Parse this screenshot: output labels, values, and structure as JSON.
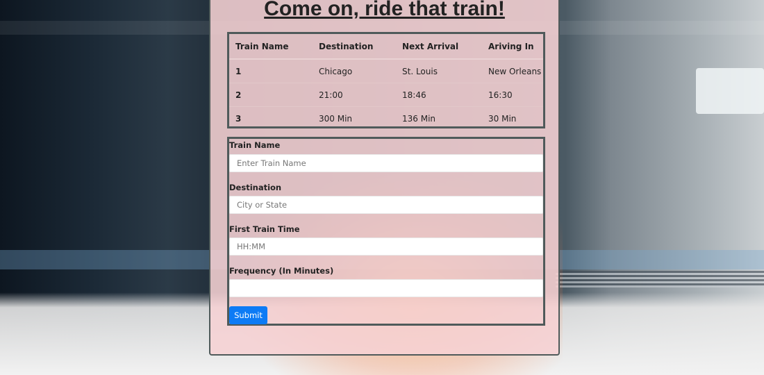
{
  "page": {
    "title": "Come on, ride that train!"
  },
  "table": {
    "headers": [
      "Train Name",
      "Destination",
      "Next Arrival",
      "Ariving In"
    ],
    "rows": [
      [
        "1",
        "Chicago",
        "St. Louis",
        "New Orleans"
      ],
      [
        "2",
        "21:00",
        "18:46",
        "16:30"
      ],
      [
        "3",
        "300 Min",
        "136 Min",
        "30 Min"
      ]
    ]
  },
  "form": {
    "train_name": {
      "label": "Train Name",
      "placeholder": "Enter Train Name",
      "value": ""
    },
    "destination": {
      "label": "Destination",
      "placeholder": "City or State",
      "value": ""
    },
    "first_time": {
      "label": "First Train Time",
      "placeholder": "HH:MM",
      "value": ""
    },
    "frequency": {
      "label": "Frequency (In Minutes)",
      "placeholder": "",
      "value": ""
    },
    "submit_label": "Submit"
  },
  "colors": {
    "panel": "#f6d2d4",
    "border": "#4f5a5a",
    "button": "#0d7bf5"
  }
}
